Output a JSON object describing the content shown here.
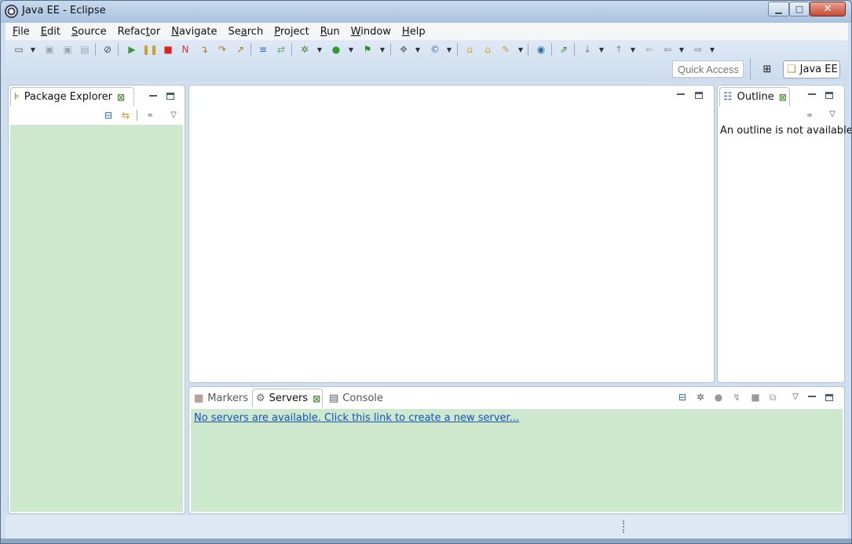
{
  "window": {
    "title": "Java EE - Eclipse"
  },
  "menu": [
    "File",
    "Edit",
    "Source",
    "Refactor",
    "Navigate",
    "Search",
    "Project",
    "Run",
    "Window",
    "Help"
  ],
  "menu_mnemonics": [
    "F",
    "E",
    "S",
    "t",
    "N",
    "a",
    "P",
    "R",
    "W",
    "H"
  ],
  "toolbar": {
    "quick_access": "Quick Access",
    "perspective": "Java EE"
  },
  "package_explorer": {
    "title": "Package Explorer"
  },
  "outline": {
    "title": "Outline",
    "message": "An outline is not available."
  },
  "bottom_panel": {
    "tabs": [
      "Markers",
      "Servers",
      "Console"
    ],
    "active_tab": "Servers",
    "servers_link": "No servers are available. Click this link to create a new server..."
  },
  "colors": {
    "view_bg": "#cde8cd",
    "link": "#1452b8",
    "window_chrome": "#cfdff0"
  }
}
